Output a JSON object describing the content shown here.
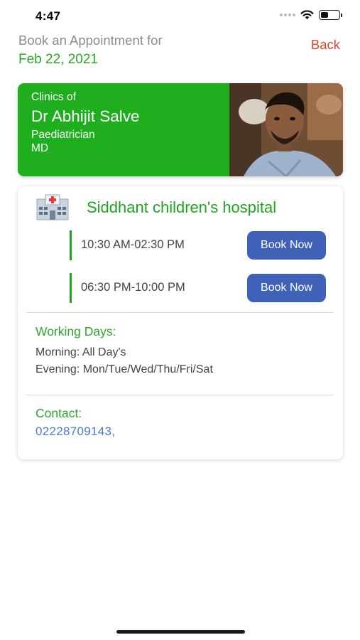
{
  "status_bar": {
    "time": "4:47"
  },
  "header": {
    "title": "Book an Appointment for",
    "date": "Feb 22, 2021",
    "back_label": "Back"
  },
  "doctor": {
    "clinics_of": "Clinics of",
    "name": "Dr Abhijit Salve",
    "specialty": "Paediatrician",
    "degree": "MD"
  },
  "clinic": {
    "name": "Siddhant children's hospital",
    "slots": [
      {
        "time": "10:30 AM-02:30 PM",
        "button": "Book Now"
      },
      {
        "time": "06:30 PM-10:00 PM",
        "button": "Book Now"
      }
    ],
    "working_days_label": "Working Days:",
    "morning": "Morning: All Day's",
    "evening": "Evening: Mon/Tue/Wed/Thu/Fri/Sat",
    "contact_label": "Contact:",
    "phone": "02228709143,"
  },
  "colors": {
    "accent_green": "#1eae1e",
    "back_red": "#e2452c",
    "button_blue": "#3f61b7",
    "link_blue": "#4a7bd3"
  },
  "icons": [
    "wifi-icon",
    "battery-icon",
    "hospital-icon"
  ]
}
